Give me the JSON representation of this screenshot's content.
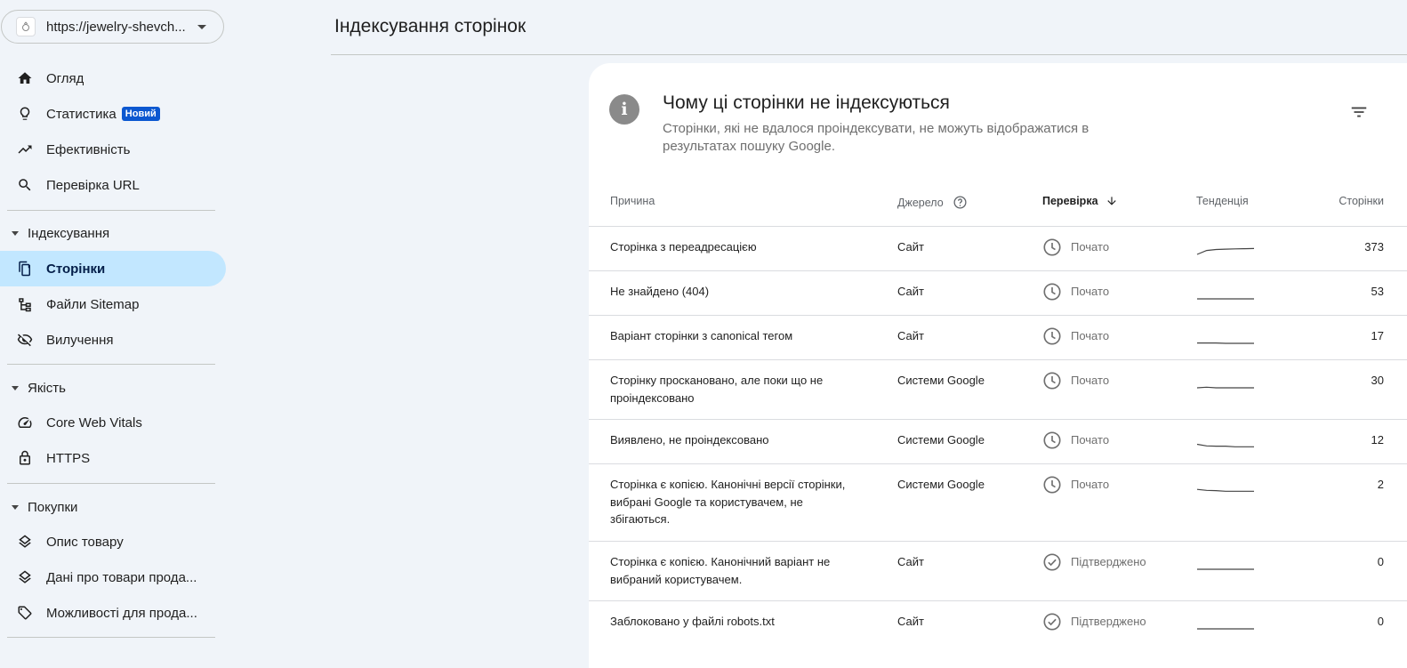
{
  "property": {
    "url": "https://jewelry-shevch...",
    "favicon": "ring-icon"
  },
  "nav": {
    "overview": "Огляд",
    "insights": "Статистика",
    "insights_badge": "Новий",
    "performance": "Ефективність",
    "url_inspection": "Перевірка URL",
    "indexing_section": "Індексування",
    "pages": "Сторінки",
    "sitemaps": "Файли Sitemap",
    "removals": "Вилучення",
    "quality_section": "Якість",
    "cwv": "Core Web Vitals",
    "https": "HTTPS",
    "shopping_section": "Покупки",
    "product_snippets": "Опис товару",
    "merchant_listings": "Дані про товари прода...",
    "shopping_tab": "Можливості для прода..."
  },
  "header": {
    "title": "Індексування сторінок"
  },
  "card": {
    "title": "Чому ці сторінки не індексуються",
    "subtitle": "Сторінки, які не вдалося проіндексувати, не можуть відображатися в результатах пошуку Google."
  },
  "table": {
    "columns": {
      "reason": "Причина",
      "source": "Джерело",
      "validation": "Перевірка",
      "trend": "Тенденція",
      "pages": "Сторінки"
    },
    "rows": [
      {
        "reason": "Сторінка з переадресацією",
        "source": "Сайт",
        "validation": "Почато",
        "status_icon": "clock-icon",
        "trend": [
          3,
          1,
          0.5,
          0.3,
          0.2,
          0.1,
          0
        ],
        "pages": "373"
      },
      {
        "reason": "Не знайдено (404)",
        "source": "Сайт",
        "validation": "Почато",
        "status_icon": "clock-icon",
        "trend": [
          0,
          0,
          0,
          0,
          0,
          0,
          0
        ],
        "pages": "53"
      },
      {
        "reason": "Варіант сторінки з canonical тегом",
        "source": "Сайт",
        "validation": "Почато",
        "status_icon": "clock-icon",
        "trend": [
          0.3,
          0.3,
          0.3,
          0,
          0,
          0,
          0
        ],
        "pages": "17"
      },
      {
        "reason": "Сторінку проскановано, але поки що не проіндексовано",
        "source": "Системи Google",
        "validation": "Почато",
        "status_icon": "clock-icon",
        "trend": [
          0,
          0.5,
          0,
          0,
          0,
          0,
          0
        ],
        "pages": "30"
      },
      {
        "reason": "Виявлено, не проіндексовано",
        "source": "Системи Google",
        "validation": "Почато",
        "status_icon": "clock-icon",
        "trend": [
          2.5,
          1.2,
          1,
          1,
          0.5,
          0.5,
          0.5
        ],
        "pages": "12"
      },
      {
        "reason": "Сторінка є копією. Канонічні версії сторінки, вибрані Google та користувачем, не збігаються.",
        "source": "Системи Google",
        "validation": "Почато",
        "status_icon": "clock-icon",
        "trend": [
          2,
          1.2,
          1,
          0.5,
          0.5,
          0.5,
          0.5
        ],
        "pages": "2"
      },
      {
        "reason": "Сторінка є копією. Канонічний варіант не вибраний користувачем.",
        "source": "Сайт",
        "validation": "Підтверджено",
        "status_icon": "check-circle-icon",
        "trend": [
          0,
          0,
          0,
          0,
          0,
          0,
          0
        ],
        "pages": "0"
      },
      {
        "reason": "Заблоковано у файлі robots.txt",
        "source": "Сайт",
        "validation": "Підтверджено",
        "status_icon": "check-circle-icon",
        "trend": [
          0,
          0,
          0,
          0,
          0,
          0,
          0
        ],
        "pages": "0"
      }
    ]
  }
}
